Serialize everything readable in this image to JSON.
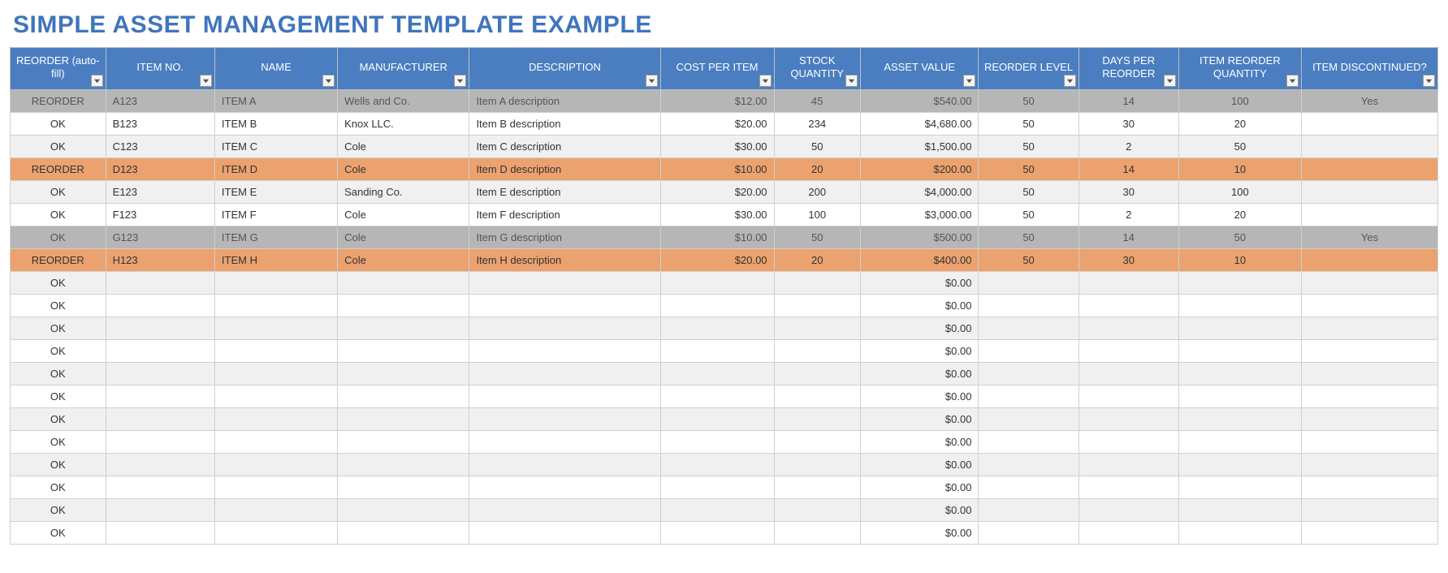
{
  "title": "SIMPLE ASSET MANAGEMENT TEMPLATE EXAMPLE",
  "columns": [
    {
      "label": "REORDER (auto-fill)",
      "align": "center",
      "wclass": "w-status"
    },
    {
      "label": "ITEM NO.",
      "align": "left",
      "wclass": "w-item"
    },
    {
      "label": "NAME",
      "align": "left",
      "wclass": "w-name"
    },
    {
      "label": "MANUFACTURER",
      "align": "left",
      "wclass": "w-mfr"
    },
    {
      "label": "DESCRIPTION",
      "align": "left",
      "wclass": "w-desc"
    },
    {
      "label": "COST PER ITEM",
      "align": "right",
      "wclass": "w-cost"
    },
    {
      "label": "STOCK QUANTITY",
      "align": "center",
      "wclass": "w-qty"
    },
    {
      "label": "ASSET VALUE",
      "align": "right",
      "wclass": "w-value"
    },
    {
      "label": "REORDER LEVEL",
      "align": "center",
      "wclass": "w-level"
    },
    {
      "label": "DAYS PER REORDER",
      "align": "center",
      "wclass": "w-days"
    },
    {
      "label": "ITEM REORDER QUANTITY",
      "align": "center",
      "wclass": "w-reqty"
    },
    {
      "label": "ITEM DISCONTINUED?",
      "align": "center",
      "wclass": "w-disc"
    }
  ],
  "rows": [
    {
      "style": "gray",
      "status": "REORDER",
      "item": "A123",
      "name": "ITEM A",
      "mfr": "Wells and Co.",
      "desc": "Item A description",
      "cost": "$12.00",
      "qty": "45",
      "value": "$540.00",
      "level": "50",
      "days": "14",
      "reqty": "100",
      "disc": "Yes"
    },
    {
      "style": "normal",
      "status": "OK",
      "item": "B123",
      "name": "ITEM B",
      "mfr": "Knox LLC.",
      "desc": "Item B description",
      "cost": "$20.00",
      "qty": "234",
      "value": "$4,680.00",
      "level": "50",
      "days": "30",
      "reqty": "20",
      "disc": ""
    },
    {
      "style": "alt",
      "status": "OK",
      "item": "C123",
      "name": "ITEM C",
      "mfr": "Cole",
      "desc": "Item C description",
      "cost": "$30.00",
      "qty": "50",
      "value": "$1,500.00",
      "level": "50",
      "days": "2",
      "reqty": "50",
      "disc": ""
    },
    {
      "style": "orange",
      "status": "REORDER",
      "item": "D123",
      "name": "ITEM D",
      "mfr": "Cole",
      "desc": "Item D description",
      "cost": "$10.00",
      "qty": "20",
      "value": "$200.00",
      "level": "50",
      "days": "14",
      "reqty": "10",
      "disc": ""
    },
    {
      "style": "alt",
      "status": "OK",
      "item": "E123",
      "name": "ITEM E",
      "mfr": "Sanding Co.",
      "desc": "Item E description",
      "cost": "$20.00",
      "qty": "200",
      "value": "$4,000.00",
      "level": "50",
      "days": "30",
      "reqty": "100",
      "disc": ""
    },
    {
      "style": "normal",
      "status": "OK",
      "item": "F123",
      "name": "ITEM F",
      "mfr": "Cole",
      "desc": "Item F description",
      "cost": "$30.00",
      "qty": "100",
      "value": "$3,000.00",
      "level": "50",
      "days": "2",
      "reqty": "20",
      "disc": ""
    },
    {
      "style": "gray",
      "status": "OK",
      "item": "G123",
      "name": "ITEM G",
      "mfr": "Cole",
      "desc": "Item G description",
      "cost": "$10.00",
      "qty": "50",
      "value": "$500.00",
      "level": "50",
      "days": "14",
      "reqty": "50",
      "disc": "Yes"
    },
    {
      "style": "orange",
      "status": "REORDER",
      "item": "H123",
      "name": "ITEM H",
      "mfr": "Cole",
      "desc": "Item H description",
      "cost": "$20.00",
      "qty": "20",
      "value": "$400.00",
      "level": "50",
      "days": "30",
      "reqty": "10",
      "disc": ""
    },
    {
      "style": "alt",
      "status": "OK",
      "item": "",
      "name": "",
      "mfr": "",
      "desc": "",
      "cost": "",
      "qty": "",
      "value": "$0.00",
      "level": "",
      "days": "",
      "reqty": "",
      "disc": ""
    },
    {
      "style": "normal",
      "status": "OK",
      "item": "",
      "name": "",
      "mfr": "",
      "desc": "",
      "cost": "",
      "qty": "",
      "value": "$0.00",
      "level": "",
      "days": "",
      "reqty": "",
      "disc": ""
    },
    {
      "style": "alt",
      "status": "OK",
      "item": "",
      "name": "",
      "mfr": "",
      "desc": "",
      "cost": "",
      "qty": "",
      "value": "$0.00",
      "level": "",
      "days": "",
      "reqty": "",
      "disc": ""
    },
    {
      "style": "normal",
      "status": "OK",
      "item": "",
      "name": "",
      "mfr": "",
      "desc": "",
      "cost": "",
      "qty": "",
      "value": "$0.00",
      "level": "",
      "days": "",
      "reqty": "",
      "disc": ""
    },
    {
      "style": "alt",
      "status": "OK",
      "item": "",
      "name": "",
      "mfr": "",
      "desc": "",
      "cost": "",
      "qty": "",
      "value": "$0.00",
      "level": "",
      "days": "",
      "reqty": "",
      "disc": ""
    },
    {
      "style": "normal",
      "status": "OK",
      "item": "",
      "name": "",
      "mfr": "",
      "desc": "",
      "cost": "",
      "qty": "",
      "value": "$0.00",
      "level": "",
      "days": "",
      "reqty": "",
      "disc": ""
    },
    {
      "style": "alt",
      "status": "OK",
      "item": "",
      "name": "",
      "mfr": "",
      "desc": "",
      "cost": "",
      "qty": "",
      "value": "$0.00",
      "level": "",
      "days": "",
      "reqty": "",
      "disc": ""
    },
    {
      "style": "normal",
      "status": "OK",
      "item": "",
      "name": "",
      "mfr": "",
      "desc": "",
      "cost": "",
      "qty": "",
      "value": "$0.00",
      "level": "",
      "days": "",
      "reqty": "",
      "disc": ""
    },
    {
      "style": "alt",
      "status": "OK",
      "item": "",
      "name": "",
      "mfr": "",
      "desc": "",
      "cost": "",
      "qty": "",
      "value": "$0.00",
      "level": "",
      "days": "",
      "reqty": "",
      "disc": ""
    },
    {
      "style": "normal",
      "status": "OK",
      "item": "",
      "name": "",
      "mfr": "",
      "desc": "",
      "cost": "",
      "qty": "",
      "value": "$0.00",
      "level": "",
      "days": "",
      "reqty": "",
      "disc": ""
    },
    {
      "style": "alt",
      "status": "OK",
      "item": "",
      "name": "",
      "mfr": "",
      "desc": "",
      "cost": "",
      "qty": "",
      "value": "$0.00",
      "level": "",
      "days": "",
      "reqty": "",
      "disc": ""
    },
    {
      "style": "normal",
      "status": "OK",
      "item": "",
      "name": "",
      "mfr": "",
      "desc": "",
      "cost": "",
      "qty": "",
      "value": "$0.00",
      "level": "",
      "days": "",
      "reqty": "",
      "disc": ""
    }
  ]
}
